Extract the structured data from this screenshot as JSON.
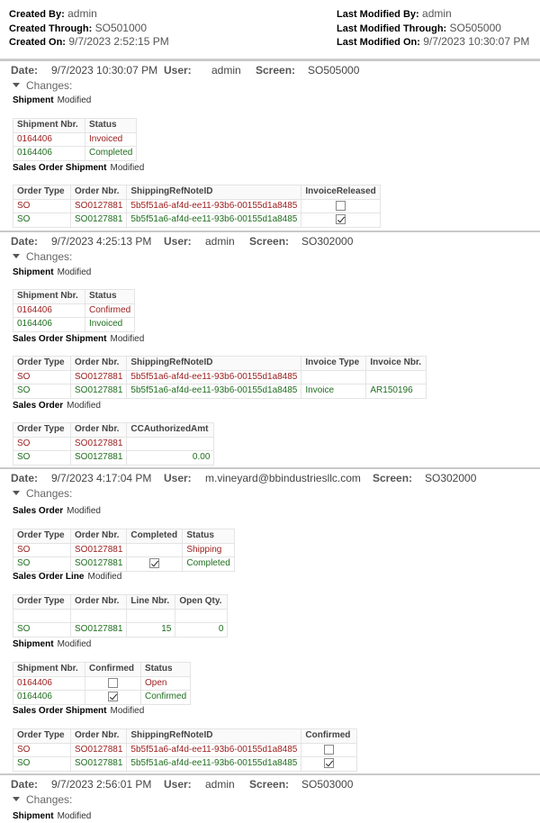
{
  "header": {
    "created_by_label": "Created By:",
    "created_by": "admin",
    "created_through_label": "Created Through:",
    "created_through": "SO501000",
    "created_on_label": "Created On:",
    "created_on": "9/7/2023 2:52:15 PM",
    "last_modified_by_label": "Last Modified By:",
    "last_modified_by": "admin",
    "last_modified_through_label": "Last Modified Through:",
    "last_modified_through": "SO505000",
    "last_modified_on_label": "Last Modified On:",
    "last_modified_on": "9/7/2023 10:30:07 PM"
  },
  "labels": {
    "date": "Date:",
    "user": "User:",
    "screen": "Screen:",
    "changes": "Changes:",
    "modified": "Modified"
  },
  "entries": [
    {
      "date": "9/7/2023 10:30:07 PM",
      "user": "admin",
      "screen": "SO505000",
      "sections": [
        {
          "name": "Shipment",
          "columns": [
            "Shipment Nbr.",
            "Status"
          ],
          "rows": [
            {
              "kind": "old",
              "cells": [
                "0164406",
                "Invoiced"
              ]
            },
            {
              "kind": "new",
              "cells": [
                "0164406",
                "Completed"
              ]
            }
          ]
        },
        {
          "name": "Sales Order Shipment",
          "columns": [
            "Order Type",
            "Order Nbr.",
            "ShippingRefNoteID",
            "InvoiceReleased"
          ],
          "rows": [
            {
              "kind": "old",
              "cells": [
                "SO",
                "SO0127881",
                "5b5f51a6-af4d-ee11-93b6-00155d1a8485",
                "unchecked"
              ]
            },
            {
              "kind": "new",
              "cells": [
                "SO",
                "SO0127881",
                "5b5f51a6-af4d-ee11-93b6-00155d1a8485",
                "checked"
              ]
            }
          ]
        }
      ]
    },
    {
      "date": "9/7/2023 4:25:13 PM",
      "user": "admin",
      "screen": "SO302000",
      "sections": [
        {
          "name": "Shipment",
          "columns": [
            "Shipment Nbr.",
            "Status"
          ],
          "rows": [
            {
              "kind": "old",
              "cells": [
                "0164406",
                "Confirmed"
              ]
            },
            {
              "kind": "new",
              "cells": [
                "0164406",
                "Invoiced"
              ]
            }
          ]
        },
        {
          "name": "Sales Order Shipment",
          "columns": [
            "Order Type",
            "Order Nbr.",
            "ShippingRefNoteID",
            "Invoice Type",
            "Invoice Nbr."
          ],
          "rows": [
            {
              "kind": "old",
              "cells": [
                "SO",
                "SO0127881",
                "5b5f51a6-af4d-ee11-93b6-00155d1a8485",
                "",
                ""
              ]
            },
            {
              "kind": "new",
              "cells": [
                "SO",
                "SO0127881",
                "5b5f51a6-af4d-ee11-93b6-00155d1a8485",
                "Invoice",
                "AR150196"
              ]
            }
          ]
        },
        {
          "name": "Sales Order",
          "columns": [
            "Order Type",
            "Order Nbr.",
            "CCAuthorizedAmt"
          ],
          "rows": [
            {
              "kind": "old",
              "cells": [
                "SO",
                "SO0127881",
                ""
              ]
            },
            {
              "kind": "new",
              "cells": [
                "SO",
                "SO0127881",
                "0.00"
              ]
            }
          ]
        }
      ]
    },
    {
      "date": "9/7/2023 4:17:04 PM",
      "user": "m.vineyard@bbindustriesllc.com",
      "screen": "SO302000",
      "sections": [
        {
          "name": "Sales Order",
          "columns": [
            "Order Type",
            "Order Nbr.",
            "Completed",
            "Status"
          ],
          "rows": [
            {
              "kind": "old",
              "cells": [
                "SO",
                "SO0127881",
                "",
                "Shipping"
              ]
            },
            {
              "kind": "new",
              "cells": [
                "SO",
                "SO0127881",
                "checked",
                "Completed"
              ]
            }
          ]
        },
        {
          "name": "Sales Order Line",
          "columns": [
            "Order Type",
            "Order Nbr.",
            "Line Nbr.",
            "Open Qty."
          ],
          "rows": [
            {
              "kind": "old",
              "cells": [
                "",
                "",
                "",
                ""
              ]
            },
            {
              "kind": "new",
              "cells": [
                "SO",
                "SO0127881",
                "15",
                "0"
              ]
            }
          ]
        },
        {
          "name": "Shipment",
          "columns": [
            "Shipment Nbr.",
            "Confirmed",
            "Status"
          ],
          "rows": [
            {
              "kind": "old",
              "cells": [
                "0164406",
                "unchecked",
                "Open"
              ]
            },
            {
              "kind": "new",
              "cells": [
                "0164406",
                "checked",
                "Confirmed"
              ]
            }
          ]
        },
        {
          "name": "Sales Order Shipment",
          "columns": [
            "Order Type",
            "Order Nbr.",
            "ShippingRefNoteID",
            "Confirmed"
          ],
          "rows": [
            {
              "kind": "old",
              "cells": [
                "SO",
                "SO0127881",
                "5b5f51a6-af4d-ee11-93b6-00155d1a8485",
                "unchecked"
              ]
            },
            {
              "kind": "new",
              "cells": [
                "SO",
                "SO0127881",
                "5b5f51a6-af4d-ee11-93b6-00155d1a8485",
                "checked"
              ]
            }
          ]
        }
      ]
    },
    {
      "date": "9/7/2023 2:56:01 PM",
      "user": "admin",
      "screen": "SO503000",
      "sections": [
        {
          "name": "Shipment",
          "columns": [],
          "rows": []
        }
      ]
    }
  ]
}
